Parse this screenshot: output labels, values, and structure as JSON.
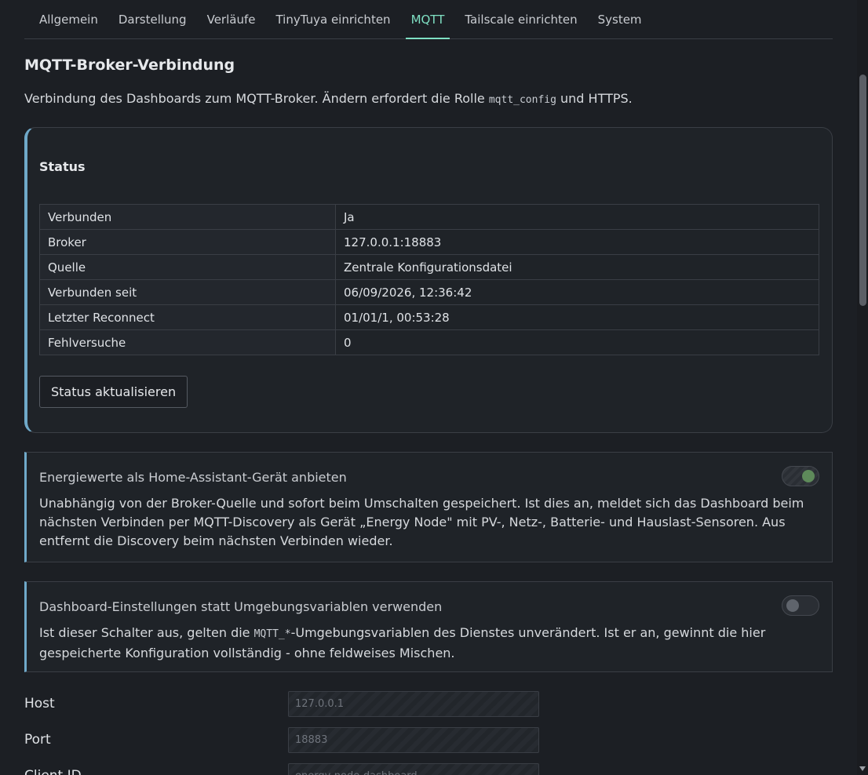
{
  "tabs": [
    {
      "label": "Allgemein"
    },
    {
      "label": "Darstellung"
    },
    {
      "label": "Verläufe"
    },
    {
      "label": "TinyTuya einrichten"
    },
    {
      "label": "MQTT"
    },
    {
      "label": "Tailscale einrichten"
    },
    {
      "label": "System"
    }
  ],
  "active_tab": "MQTT",
  "section": {
    "title": "MQTT-Broker-Verbindung",
    "intro_before": "Verbindung des Dashboards zum MQTT-Broker. Ändern erfordert die Rolle ",
    "intro_code": "mqtt_config",
    "intro_after": " und HTTPS."
  },
  "status": {
    "title": "Status",
    "rows": [
      {
        "key": "Verbunden",
        "value": "Ja"
      },
      {
        "key": "Broker",
        "value": "127.0.0.1:18883"
      },
      {
        "key": "Quelle",
        "value": "Zentrale Konfigurationsdatei"
      },
      {
        "key": "Verbunden seit",
        "value": "06/09/2026, 12:36:42"
      },
      {
        "key": "Letzter Reconnect",
        "value": "01/01/1, 00:53:28"
      },
      {
        "key": "Fehlversuche",
        "value": "0"
      }
    ],
    "refresh_label": "Status aktualisieren"
  },
  "discovery": {
    "title": "Energiewerte als Home-Assistant-Gerät anbieten",
    "description": "Unabhängig von der Broker-Quelle und sofort beim Umschalten gespeichert. Ist dies an, meldet sich das Dashboard beim nächsten Verbinden per MQTT-Discovery als Gerät „Energy Node\" mit PV-, Netz-, Batterie- und Hauslast-Sensoren. Aus entfernt die Discovery beim nächsten Verbinden wieder.",
    "enabled": true
  },
  "override": {
    "title": "Dashboard-Einstellungen statt Umgebungsvariablen verwenden",
    "desc_before": "Ist dieser Schalter aus, gelten die ",
    "desc_code": "MQTT_*",
    "desc_after": "-Umgebungsvariablen des Dienstes unverändert. Ist er an, gewinnt die hier gespeicherte Konfiguration vollständig - ohne feldweises Mischen.",
    "enabled": false
  },
  "form": {
    "host_label": "Host",
    "host_placeholder": "127.0.0.1",
    "port_label": "Port",
    "port_placeholder": "18883",
    "client_id_label": "Client ID",
    "client_id_placeholder": "energy-node-dashboard"
  }
}
